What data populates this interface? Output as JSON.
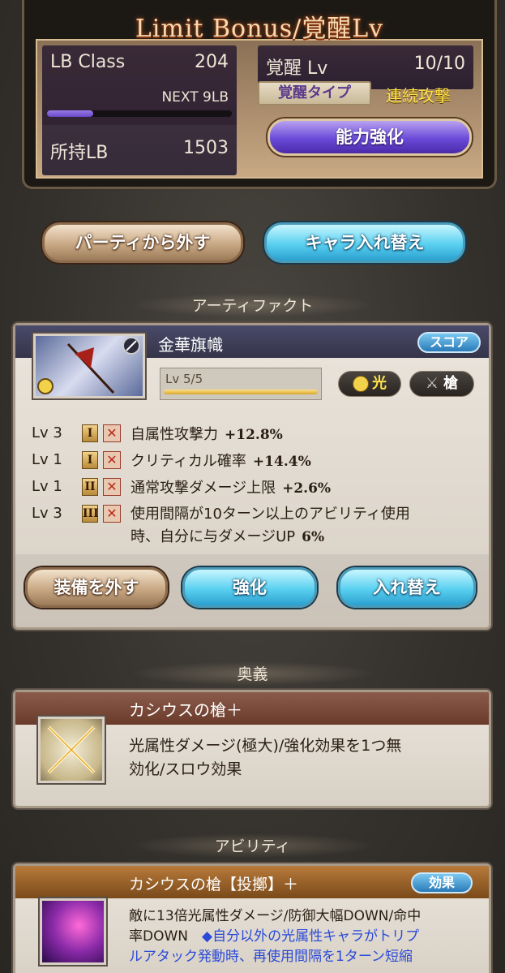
{
  "limit_bonus": {
    "title": "Limit Bonus/覚醒Lv",
    "lb_class_label": "LB Class",
    "lb_class_value": "204",
    "next_label": "NEXT 9LB",
    "progress": 0.25,
    "owned_label": "所持LB",
    "owned_value": "1503",
    "awaken_label": "覚醒 Lv",
    "awaken_value": "10/10",
    "awaken_type_label": "覚醒タイプ",
    "awaken_type_value": "連続攻撃",
    "enhance_button": "能力強化"
  },
  "actions": {
    "remove_party": "パーティから外す",
    "swap_chara": "キャラ入れ替え"
  },
  "artifact": {
    "section_title": "アーティファクト",
    "name": "金華旗幟",
    "score_button": "スコア",
    "level": "Lv 5/5",
    "element": "光",
    "weapon": "槍",
    "skills": [
      {
        "lv": "Lv 3",
        "tier": "I",
        "text": "自属性攻撃力",
        "value": "+12.8%"
      },
      {
        "lv": "Lv 1",
        "tier": "I",
        "text": "クリティカル確率",
        "value": "+14.4%"
      },
      {
        "lv": "Lv 1",
        "tier": "II",
        "text": "通常攻撃ダメージ上限",
        "value": "+2.6%"
      },
      {
        "lv": "Lv 3",
        "tier": "III",
        "text": "使用間隔が10ターン以上のアビリティ使用",
        "text2": "時、自分に与ダメージUP",
        "value": "6%"
      }
    ],
    "unequip_button": "装備を外す",
    "enhance_button": "強化",
    "swap_button": "入れ替え"
  },
  "ougi": {
    "section_title": "奥義",
    "name": "カシウスの槍＋",
    "desc_line1": "光属性ダメージ(極大)/強化効果を1つ無",
    "desc_line2": "効化/スロウ効果"
  },
  "ability": {
    "section_title": "アビリティ",
    "name": "カシウスの槍【投擲】＋",
    "effect_button": "効果",
    "desc_line1": "敵に13倍光属性ダメージ/防御大幅DOWN/命中",
    "desc_line2a": "率DOWN",
    "desc_line2b": "◆自分以外の光属性キャラがトリプ",
    "desc_line3": "ルアタック発動時、再使用間隔を1ターン短縮"
  },
  "colors": {
    "accent_purple": "#6a4ad8",
    "accent_cyan": "#5ad0f0",
    "gold": "#ffe24a"
  }
}
